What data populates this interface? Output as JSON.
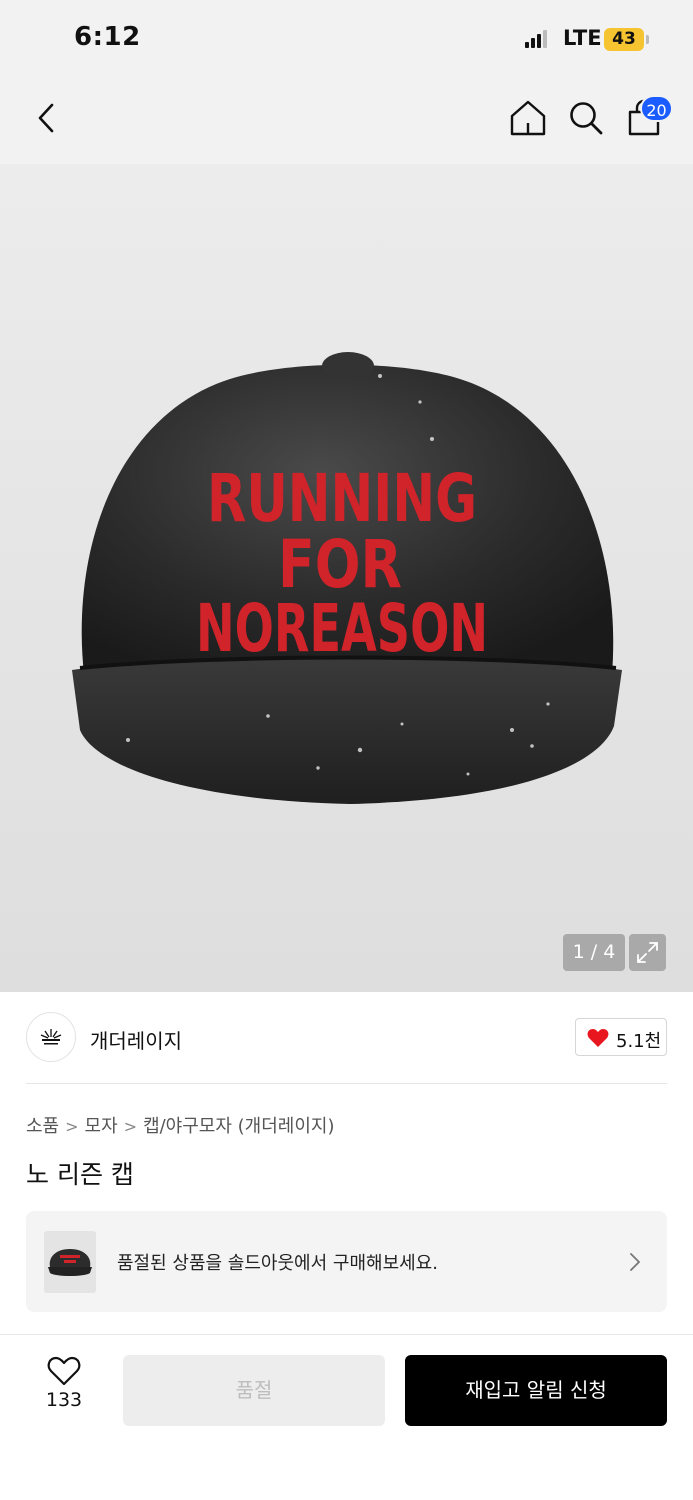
{
  "status_bar": {
    "time": "6:12",
    "network": "LTE",
    "battery": "43"
  },
  "nav": {
    "cart_count": "20"
  },
  "image": {
    "cap_text_line1": "RUNNING",
    "cap_text_line2": "FOR",
    "cap_text_line3": "NOREASON",
    "counter": "1 / 4"
  },
  "brand": {
    "name": "개더레이지",
    "likes": "5.1천"
  },
  "breadcrumb": {
    "level1": "소품",
    "level2": "모자",
    "level3": "캡/야구모자 (개더레이지)"
  },
  "product": {
    "title": "노 리즌 캡"
  },
  "soldout_card": {
    "text": "품절된 상품을 솔드아웃에서 구매해보세요."
  },
  "bottom_bar": {
    "wish_count": "133",
    "soldout_label": "품절",
    "restock_label": "재입고 알림 신청"
  },
  "colors": {
    "accent": "#1a5cff",
    "heart": "#e8161e",
    "battery": "#f6c431",
    "cap_text": "#d1232a"
  }
}
